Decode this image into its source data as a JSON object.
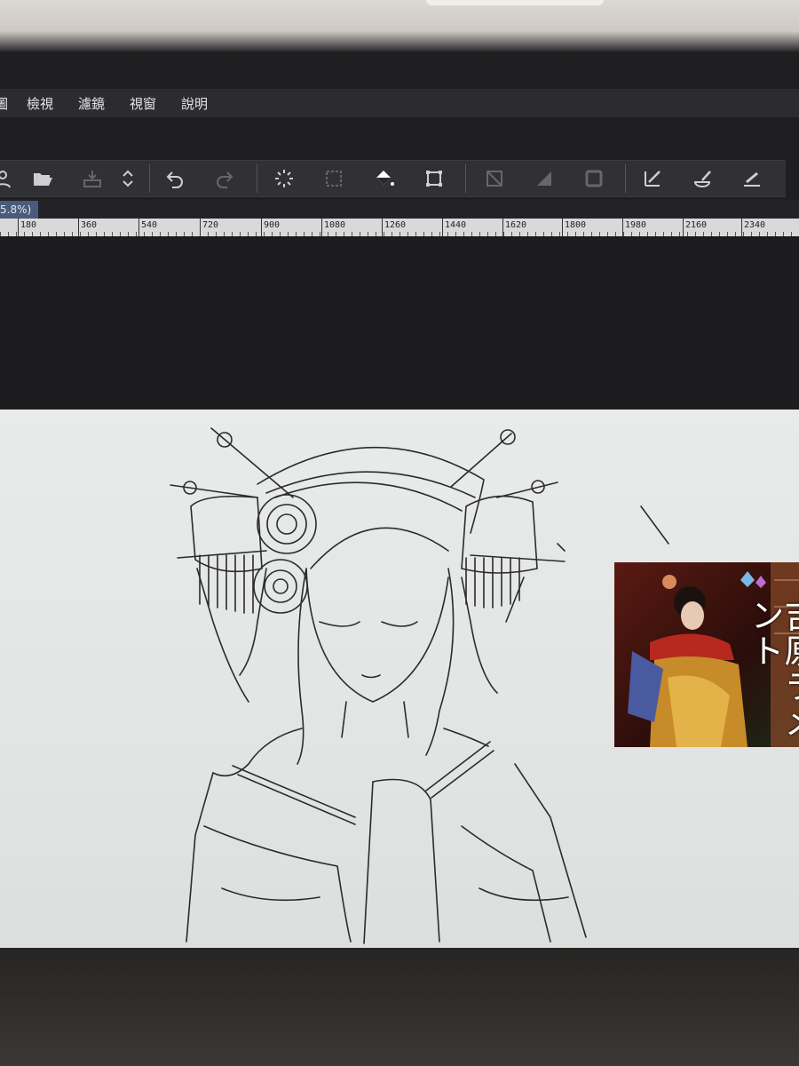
{
  "menubar": {
    "items": [
      {
        "label": "圖"
      },
      {
        "label": "檢視"
      },
      {
        "label": "濾鏡"
      },
      {
        "label": "視窗"
      },
      {
        "label": "說明"
      }
    ]
  },
  "toolbar": {
    "tools": [
      {
        "icon": "user-icon",
        "enabled": true
      },
      {
        "icon": "folder-open-icon",
        "enabled": true
      },
      {
        "icon": "save-icon",
        "enabled": false
      },
      {
        "icon": "up-down-arrows-icon",
        "enabled": true
      },
      {
        "icon": "undo-icon",
        "enabled": true
      },
      {
        "icon": "redo-icon",
        "enabled": false
      },
      {
        "icon": "loading-spinner-icon",
        "enabled": true
      },
      {
        "icon": "transform-icon",
        "enabled": false
      },
      {
        "icon": "fill-bucket-icon",
        "enabled": true
      },
      {
        "icon": "crop-icon",
        "enabled": true
      },
      {
        "icon": "selection-clear-icon",
        "enabled": false
      },
      {
        "icon": "invert-selection-icon",
        "enabled": false
      },
      {
        "icon": "selection-border-icon",
        "enabled": false
      },
      {
        "icon": "selection-pen-icon",
        "enabled": true
      },
      {
        "icon": "selection-brush-icon",
        "enabled": true
      },
      {
        "icon": "selection-eraser-icon",
        "enabled": true
      }
    ]
  },
  "zoom": {
    "label": "5.8%)"
  },
  "ruler": {
    "labels": [
      "180",
      "360",
      "540",
      "720",
      "900",
      "1080",
      "1260",
      "1440",
      "1620",
      "1800",
      "1980",
      "2160",
      "2340"
    ]
  },
  "reference_image": {
    "title": "吉原ラメント"
  },
  "colors": {
    "canvas": "#e6e8e7",
    "toolbar": "#303035",
    "menubar": "#2c2c30",
    "zoom_highlight": "#4a5a7a"
  }
}
